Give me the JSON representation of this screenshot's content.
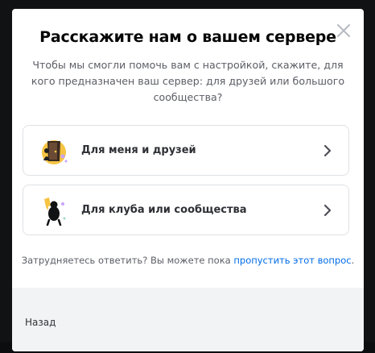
{
  "modal": {
    "title": "Расскажите нам о вашем сервере",
    "subtitle": "Чтобы мы смогли помочь вам с настройкой, скажите, для кого предназначен ваш сервер: для друзей или большого сообщества?",
    "close_icon": "close-icon"
  },
  "options": [
    {
      "label": "Для меня и друзей",
      "icon": "friends-illustration-icon"
    },
    {
      "label": "Для клуба или сообщества",
      "icon": "community-illustration-icon"
    }
  ],
  "helper": {
    "prefix": "Затрудняетесь ответить? Вы можете пока",
    "link": "пропустить этот вопрос",
    "suffix": "."
  },
  "footer": {
    "back_label": "Назад"
  },
  "colors": {
    "link": "#006ce7",
    "title": "#060607",
    "footer_bg": "#f2f3f5"
  }
}
